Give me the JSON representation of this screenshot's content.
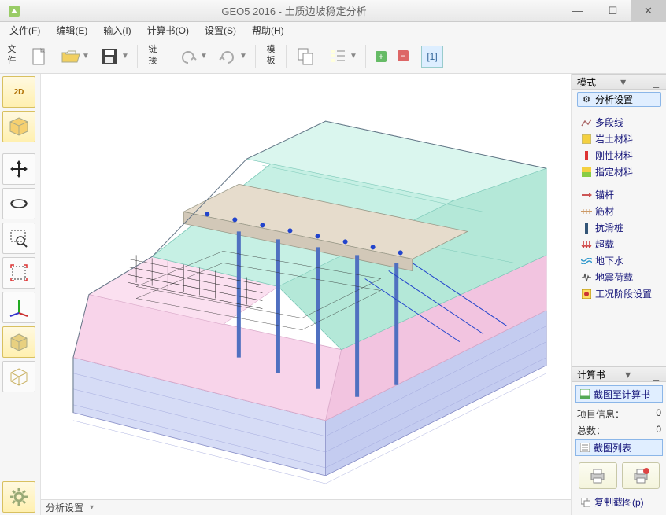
{
  "window": {
    "title": "GEO5 2016 - 土质边坡稳定分析"
  },
  "menu": {
    "file": "文件(F)",
    "edit": "编辑(E)",
    "input": "输入(I)",
    "calcbook": "计算书(O)",
    "settings": "设置(S)",
    "help": "帮助(H)"
  },
  "toolbar": {
    "new": "新建",
    "open": "打开",
    "save": "保存",
    "manager": "链接",
    "undo": "撤销",
    "redo": "重做",
    "template": "模板",
    "copy_view": "复制视图",
    "settings_list": "设置列表",
    "add": "添加",
    "remove": "删除",
    "stage": "[1]"
  },
  "left_rail": {
    "b2d": "2D",
    "b3d": "3D"
  },
  "right": {
    "modes_header": "模式",
    "calc_header": "计算书",
    "modes": {
      "analysis_settings": "分析设置",
      "polyline": "多段线",
      "soil": "岩土材料",
      "rigid": "刚性材料",
      "assign": "指定材料",
      "anchor": "锚杆",
      "reinforcement": "筋材",
      "anti_pile": "抗滑桩",
      "surcharge": "超载",
      "groundwater": "地下水",
      "seismic": "地震荷载",
      "stage_settings": "工况阶段设置"
    },
    "calc": {
      "capture_to_book": "截图至计算书",
      "project_info": "项目信息：",
      "project_info_val": "0",
      "total": "总数：",
      "total_val": "0",
      "capture_list": "截图列表",
      "copy_capture": "复制截图(p)"
    }
  },
  "status": {
    "section": "分析设置"
  },
  "chart_data": {
    "type": "3d-geology-model",
    "description": "Isometric cutaway slope model with layered strata, retaining structure with piles and anchors",
    "layers": [
      {
        "name": "top slab / pavement",
        "color": "#d8c8b8"
      },
      {
        "name": "upper soil",
        "color": "#b8f0e0"
      },
      {
        "name": "middle soil",
        "color": "#f8d0e8"
      },
      {
        "name": "lower rock",
        "color": "#d0d8f8"
      }
    ],
    "elements": [
      "anchors",
      "piles",
      "reinforcement-grid",
      "surcharge-points"
    ]
  }
}
